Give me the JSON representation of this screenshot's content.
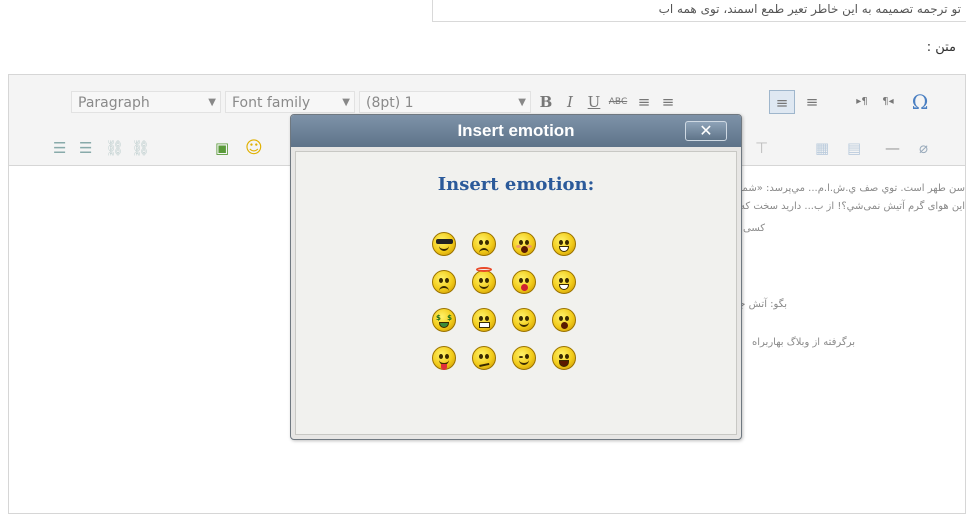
{
  "top_field": {
    "value": "تو ترجمه تصمیمه به این خاطر تعیر طمع اسمند، توی همه اب"
  },
  "field_label": "متن :",
  "toolbar": {
    "format_select": "Paragraph",
    "font_family_select": "Font family",
    "font_size_select": "(8pt) 1",
    "bold": "B",
    "italic": "I",
    "underline": "U",
    "strikethrough": "ABC",
    "align_left": "≡",
    "align_center": "≡",
    "align_right": "≡",
    "align_justify": "≡",
    "ltr": "▸¶",
    "rtl": "¶◂",
    "special_char": "Ω",
    "hr": "—"
  },
  "content_lines": [
    "سن طهر است. توي صف ي.ش.ا.م... مي‌پرسد: «شما با این چادر مشکلی توی",
    "این هوای گرم آتيش نمی‌شي؟! از ب... دارید سخت که هست ولی... ولی نمی‌گرید.",
    "کسی آنگار من گرفته زمزمه میکند:",
    "بگو: آتش جهنم گرم‌تر است.» آیه 81",
    "برگرفته از وبلاگ بهاربراه"
  ],
  "dialog": {
    "title": "Insert emotion",
    "close_label": "✕",
    "heading": "Insert emotion:"
  },
  "emoticons": [
    [
      "cool",
      "cry",
      "embarassed",
      "foot-in-mouth"
    ],
    [
      "frown",
      "innocent",
      "kiss",
      "laughing"
    ],
    [
      "money-mouth",
      "sealed",
      "smile",
      "surprised"
    ],
    [
      "tongue-out",
      "undecided",
      "wink",
      "yell"
    ]
  ]
}
